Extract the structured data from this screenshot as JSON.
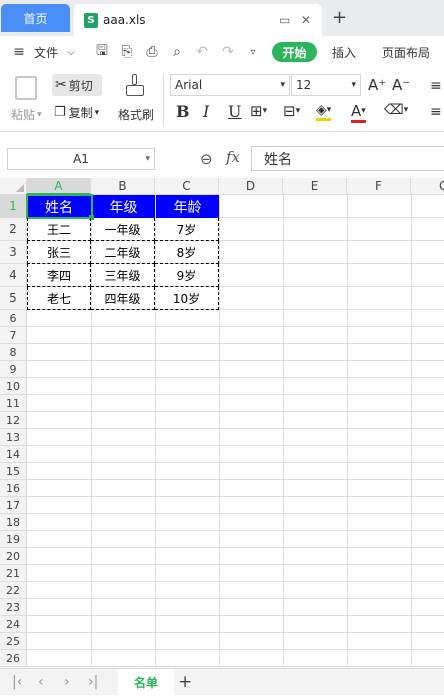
{
  "tabs": {
    "home": "首页",
    "file_icon": "S",
    "file_title": "aaa.xls"
  },
  "menu": {
    "file": "文件",
    "start": "开始",
    "insert": "插入",
    "layout": "页面布局"
  },
  "ribbon": {
    "paste": "粘贴",
    "cut": "剪切",
    "copy": "复制",
    "format_painter": "格式刷",
    "font_name": "Arial",
    "font_size": "12",
    "bold": "B",
    "italic": "I",
    "underline": "U"
  },
  "formula_bar": {
    "name_box": "A1",
    "fx": "fx",
    "formula": "姓名"
  },
  "columns": [
    "A",
    "B",
    "C",
    "D",
    "E",
    "F",
    "G"
  ],
  "rows": [
    "1",
    "2",
    "3",
    "4",
    "5",
    "6",
    "7",
    "8",
    "9",
    "10",
    "11",
    "12",
    "13",
    "14",
    "15",
    "16",
    "17",
    "18",
    "19",
    "20",
    "21",
    "22",
    "23",
    "24",
    "25",
    "26"
  ],
  "table": {
    "header": [
      "姓名",
      "年级",
      "年龄"
    ],
    "rows": [
      [
        "王二",
        "一年级",
        "7岁"
      ],
      [
        "张三",
        "二年级",
        "8岁"
      ],
      [
        "李四",
        "三年级",
        "9岁"
      ],
      [
        "老七",
        "四年级",
        "10岁"
      ]
    ]
  },
  "sheets": {
    "active": "名单"
  },
  "colors": {
    "header_fill": "#0000ff",
    "accent_green": "#2db55d",
    "home_tab": "#4a8ef7"
  }
}
